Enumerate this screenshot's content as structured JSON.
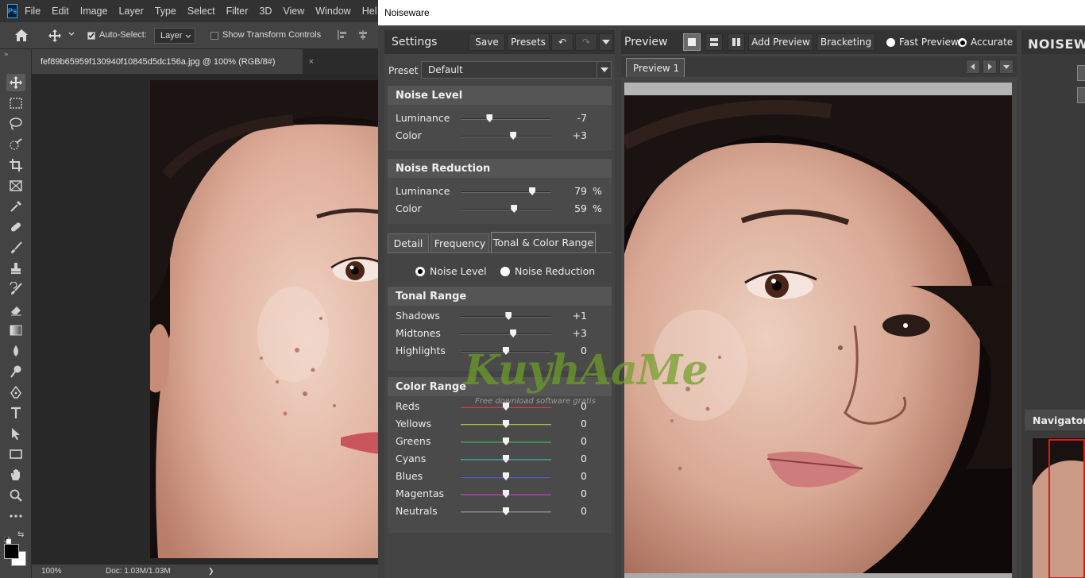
{
  "photoshop": {
    "logo": "Ps",
    "menus": [
      "File",
      "Edit",
      "Image",
      "Layer",
      "Type",
      "Select",
      "Filter",
      "3D",
      "View",
      "Window",
      "Hel"
    ],
    "options": {
      "auto_select_label": "Auto-Select:",
      "auto_select_checked": true,
      "layer_select": "Layer",
      "show_transform_label": "Show Transform Controls"
    },
    "document_tab": "fef89b65959f130940f10845d5dc156a.jpg @ 100% (RGB/8#)",
    "tab_close": "×",
    "status": {
      "zoom": "100%",
      "doc": "Doc: 1.03M/1.03M",
      "arrow": "❯"
    },
    "colors": {
      "foreground": "#000000",
      "background": "#ffffff"
    }
  },
  "noiseware": {
    "window_title": "Noiseware",
    "settings": {
      "title": "Settings",
      "save": "Save",
      "presets": "Presets",
      "undo": "↶",
      "redo": "↷",
      "preset_label": "Preset",
      "preset_value": "Default"
    },
    "noise_level": {
      "title": "Noise Level",
      "rows": [
        {
          "label": "Luminance",
          "value": "-7",
          "pos": 0.32
        },
        {
          "label": "Color",
          "value": "+3",
          "pos": 0.58
        }
      ]
    },
    "noise_reduction": {
      "title": "Noise Reduction",
      "rows": [
        {
          "label": "Luminance",
          "value": "79",
          "unit": "%",
          "pos": 0.79
        },
        {
          "label": "Color",
          "value": "59",
          "unit": "%",
          "pos": 0.59
        }
      ]
    },
    "tabs": [
      "Detail",
      "Frequency",
      "Tonal & Color Range"
    ],
    "active_tab": "Tonal & Color Range",
    "radio": {
      "noise_level": "Noise Level",
      "noise_reduction": "Noise Reduction",
      "selected": "noise_level"
    },
    "tonal_range": {
      "title": "Tonal Range",
      "rows": [
        {
          "label": "Shadows",
          "value": "+1",
          "pos": 0.53
        },
        {
          "label": "Midtones",
          "value": "+3",
          "pos": 0.58
        },
        {
          "label": "Highlights",
          "value": "0",
          "pos": 0.5
        }
      ]
    },
    "color_range": {
      "title": "Color Range",
      "rows": [
        {
          "label": "Reds",
          "value": "0",
          "pos": 0.5,
          "color": "#cc2222"
        },
        {
          "label": "Yellows",
          "value": "0",
          "pos": 0.5,
          "color": "#bbbb22"
        },
        {
          "label": "Greens",
          "value": "0",
          "pos": 0.5,
          "color": "#22aa33"
        },
        {
          "label": "Cyans",
          "value": "0",
          "pos": 0.5,
          "color": "#22aaaa"
        },
        {
          "label": "Blues",
          "value": "0",
          "pos": 0.5,
          "color": "#2233cc"
        },
        {
          "label": "Magentas",
          "value": "0",
          "pos": 0.5,
          "color": "#bb22bb"
        },
        {
          "label": "Neutrals",
          "value": "0",
          "pos": 0.5,
          "color": "#888888"
        }
      ]
    },
    "preview": {
      "title": "Preview",
      "add_preview": "Add Preview",
      "bracketing": "Bracketing",
      "fast_preview": "Fast Preview",
      "accurate": "Accurate",
      "selected_mode": "accurate",
      "tab": "Preview 1"
    },
    "right": {
      "brand": "NOISEWA",
      "navigator": "Navigator"
    }
  },
  "watermark": {
    "main": "KuyhAaMe",
    "sub": "Free download software gratis"
  }
}
